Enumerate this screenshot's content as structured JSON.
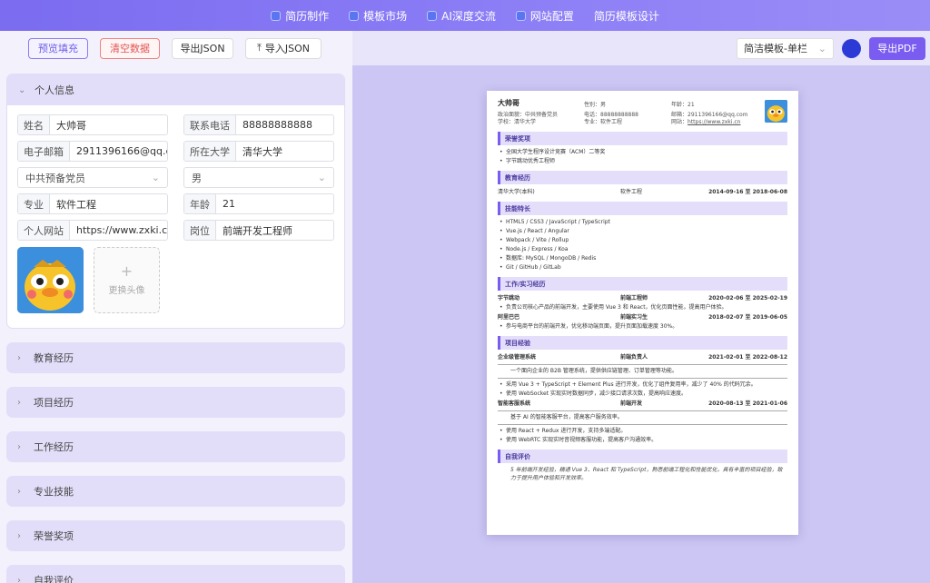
{
  "nav": {
    "items": [
      "简历制作",
      "模板市场",
      "AI深度交流",
      "网站配置",
      "简历模板设计"
    ]
  },
  "toolbar": {
    "preview": "预览填充",
    "clear": "清空数据",
    "export_json": "导出JSON",
    "import_json": "导入JSON"
  },
  "personal": {
    "title": "个人信息",
    "name_label": "姓名",
    "name": "大帅哥",
    "phone_label": "联系电话",
    "phone": "88888888888",
    "email_label": "电子邮箱",
    "email": "2911396166@qq.cor",
    "school_label": "所在大学",
    "school": "清华大学",
    "political": "中共预备党员",
    "gender": "男",
    "major_label": "专业",
    "major": "软件工程",
    "age_label": "年龄",
    "age": "21",
    "site_label": "个人网站",
    "site": "https://www.zxki.cn",
    "job_label": "岗位",
    "job": "前端开发工程师",
    "upload_label": "更换头像"
  },
  "sections": [
    "教育经历",
    "项目经历",
    "工作经历",
    "专业技能",
    "荣誉奖项",
    "自我评价"
  ],
  "right_toolbar": {
    "template": "简洁模板-单栏",
    "export_pdf": "导出PDF",
    "theme_color": "#2d3bd6"
  },
  "resume": {
    "name": "大帅哥",
    "political": "政治面貌：中共预备党员",
    "school": "学校：清华大学",
    "gender": "性别：男",
    "phone": "电话：88888888888",
    "major": "专业：软件工程",
    "age": "年龄：21",
    "email": "邮箱：2911396166@qq.com",
    "site_label": "网站：",
    "site": "https://www.zxki.cn",
    "awards_title": "荣誉奖项",
    "awards": [
      "全国大学生程序设计竞赛（ACM）二等奖",
      "字节跳动优秀工程师"
    ],
    "edu_title": "教育经历",
    "edu": {
      "school": "清华大学(本科)",
      "major": "软件工程",
      "date": "2014-09-16 至 2018-06-08"
    },
    "skills_title": "技能特长",
    "skills": [
      "HTML5 / CSS3 / JavaScript / TypeScript",
      "Vue.js / React / Angular",
      "Webpack / Vite / Rollup",
      "Node.js / Express / Koa",
      "数据库: MySQL / MongoDB / Redis",
      "Git / GitHub / GitLab"
    ],
    "work_title": "工作/实习经历",
    "work": [
      {
        "company": "字节跳动",
        "role": "前端工程师",
        "date": "2020-02-06 至 2025-02-19",
        "desc": "负责公司核心产品的前端开发，主要使用 Vue 3 和 React，优化页面性能，提高用户体验。"
      },
      {
        "company": "阿里巴巴",
        "role": "前端实习生",
        "date": "2018-02-07 至 2019-06-05",
        "desc": "参与电商平台的前端开发，优化移动端页面，提升页面加载速度 30%。"
      }
    ],
    "proj_title": "项目经验",
    "projects": [
      {
        "name": "企业级管理系统",
        "role": "前端负责人",
        "date": "2021-02-01 至 2022-08-12",
        "intro": "一个面向企业的 B2B 管理系统，提供供应链管理、订单管理等功能。",
        "points": [
          "采用 Vue 3 + TypeScript + Element Plus 进行开发，优化了组件复用率，减少了 40% 的代码冗余。",
          "使用 WebSocket 实现实时数据同步，减少接口请求次数，提高响应速度。"
        ]
      },
      {
        "name": "智能客服系统",
        "role": "前端开发",
        "date": "2020-08-13 至 2021-01-06",
        "intro": "基于 AI 的智能客服平台，提高客户服务效率。",
        "points": [
          "使用 React + Redux 进行开发，支持多端适配。",
          "使用 WebRTC 实现实时音视频客服功能，提高客户沟通效率。"
        ]
      }
    ],
    "eval_title": "自我评价",
    "eval": "5 年前端开发经验，精通 Vue 3、React 和 TypeScript，熟悉前端工程化和性能优化，具有丰富的项目经验，致力于提升用户体验和开发效率。"
  }
}
